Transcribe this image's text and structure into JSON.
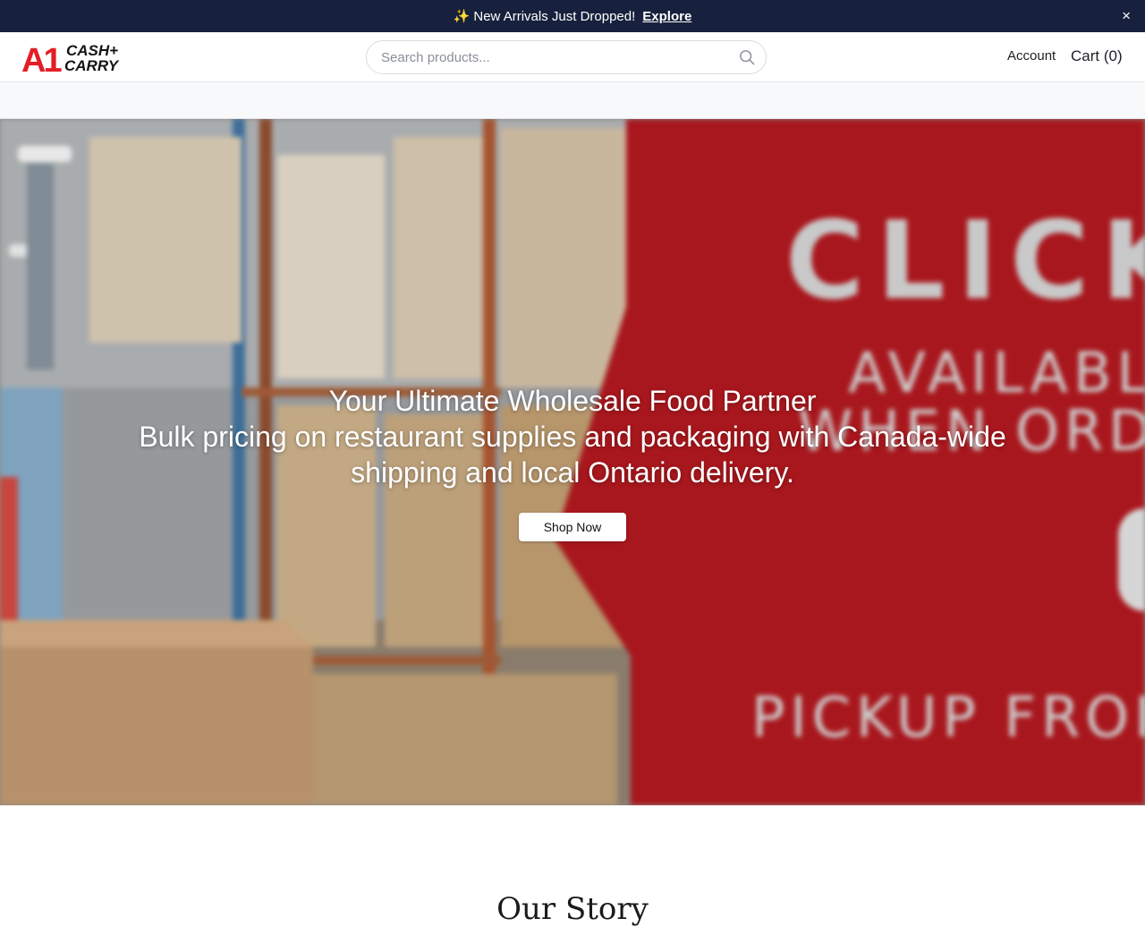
{
  "announcement": {
    "icon": "sparkles-icon",
    "text": "New Arrivals Just Dropped!",
    "link": "Explore",
    "close": "×"
  },
  "header": {
    "logo": {
      "mark": "A1",
      "line1": "CASH+",
      "line2": "CARRY"
    },
    "search_placeholder": "Search products...",
    "account": "Account",
    "cart": "Cart (0)"
  },
  "hero": {
    "title": "Your Ultimate Wholesale Food Partner",
    "subtitle": "Bulk pricing on restaurant supplies and packaging with Canada-wide shipping and local Ontario delivery.",
    "button": "Shop Now",
    "banner_text": [
      "CLICK",
      "AVAILABLE",
      "WHEN ORDER",
      "PICKUP FROM M"
    ]
  },
  "story": {
    "title": "Our Story"
  },
  "colors": {
    "announce_bg": "#17213d",
    "brand_red": "#e31e24",
    "banner_red": "#a8171d"
  }
}
